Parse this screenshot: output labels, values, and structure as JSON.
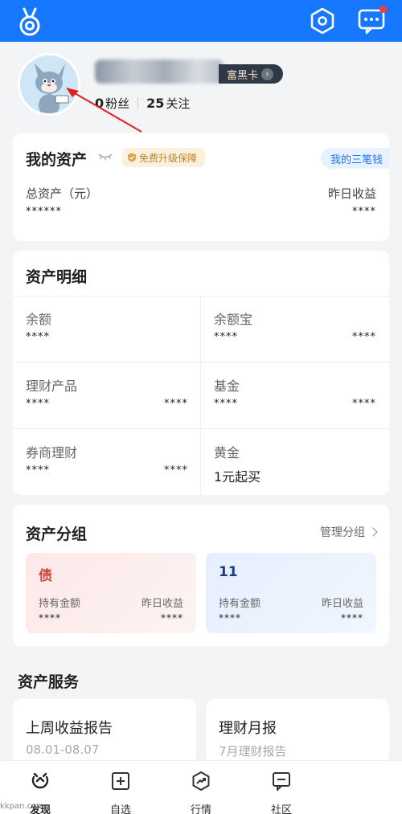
{
  "header": {
    "logo": "alipay-logo-icon",
    "settings_icon": "settings-hexagon-icon",
    "message_icon": "message-icon"
  },
  "profile": {
    "badge": "富黑卡",
    "fans_count": "0",
    "fans_label": "粉丝",
    "follow_count": "25",
    "follow_label": "关注"
  },
  "my_assets": {
    "title": "我的资产",
    "protect_label": "免费升级保障",
    "three_money_label": "我的三笔钱",
    "total_label": "总资产（元）",
    "total_value": "******",
    "yesterday_label": "昨日收益",
    "yesterday_value": "****"
  },
  "details": {
    "title": "资产明细",
    "items": [
      {
        "name": "余额",
        "v1": "****",
        "v2": ""
      },
      {
        "name": "余额宝",
        "v1": "****",
        "v2": "****"
      },
      {
        "name": "理财产品",
        "v1": "****",
        "v2": "****"
      },
      {
        "name": "基金",
        "v1": "****",
        "v2": "****"
      },
      {
        "name": "券商理财",
        "v1": "****",
        "v2": "****"
      },
      {
        "name": "黄金",
        "v1": "1元起买",
        "v2": ""
      }
    ]
  },
  "groups": {
    "title": "资产分组",
    "manage_label": "管理分组",
    "cards": [
      {
        "name": "债",
        "hold_label": "持有金额",
        "hold_value": "****",
        "yest_label": "昨日收益",
        "yest_value": "****"
      },
      {
        "name": "11",
        "hold_label": "持有金额",
        "hold_value": "****",
        "yest_label": "昨日收益",
        "yest_value": "****"
      }
    ]
  },
  "services": {
    "title": "资产服务",
    "items": [
      {
        "name": "上周收益报告",
        "sub": "08.01-08.07"
      },
      {
        "name": "理财月报",
        "sub": "7月理财报告"
      }
    ]
  },
  "nav": {
    "items": [
      {
        "label": "发现",
        "icon": "discover-icon"
      },
      {
        "label": "自选",
        "icon": "add-favorite-icon"
      },
      {
        "label": "行情",
        "icon": "market-trend-icon"
      },
      {
        "label": "社区",
        "icon": "community-icon"
      }
    ]
  },
  "watermark": "kkpan.com",
  "colors": {
    "primary": "#1677ff",
    "gold": "#b7862f",
    "danger": "#d0413b"
  }
}
